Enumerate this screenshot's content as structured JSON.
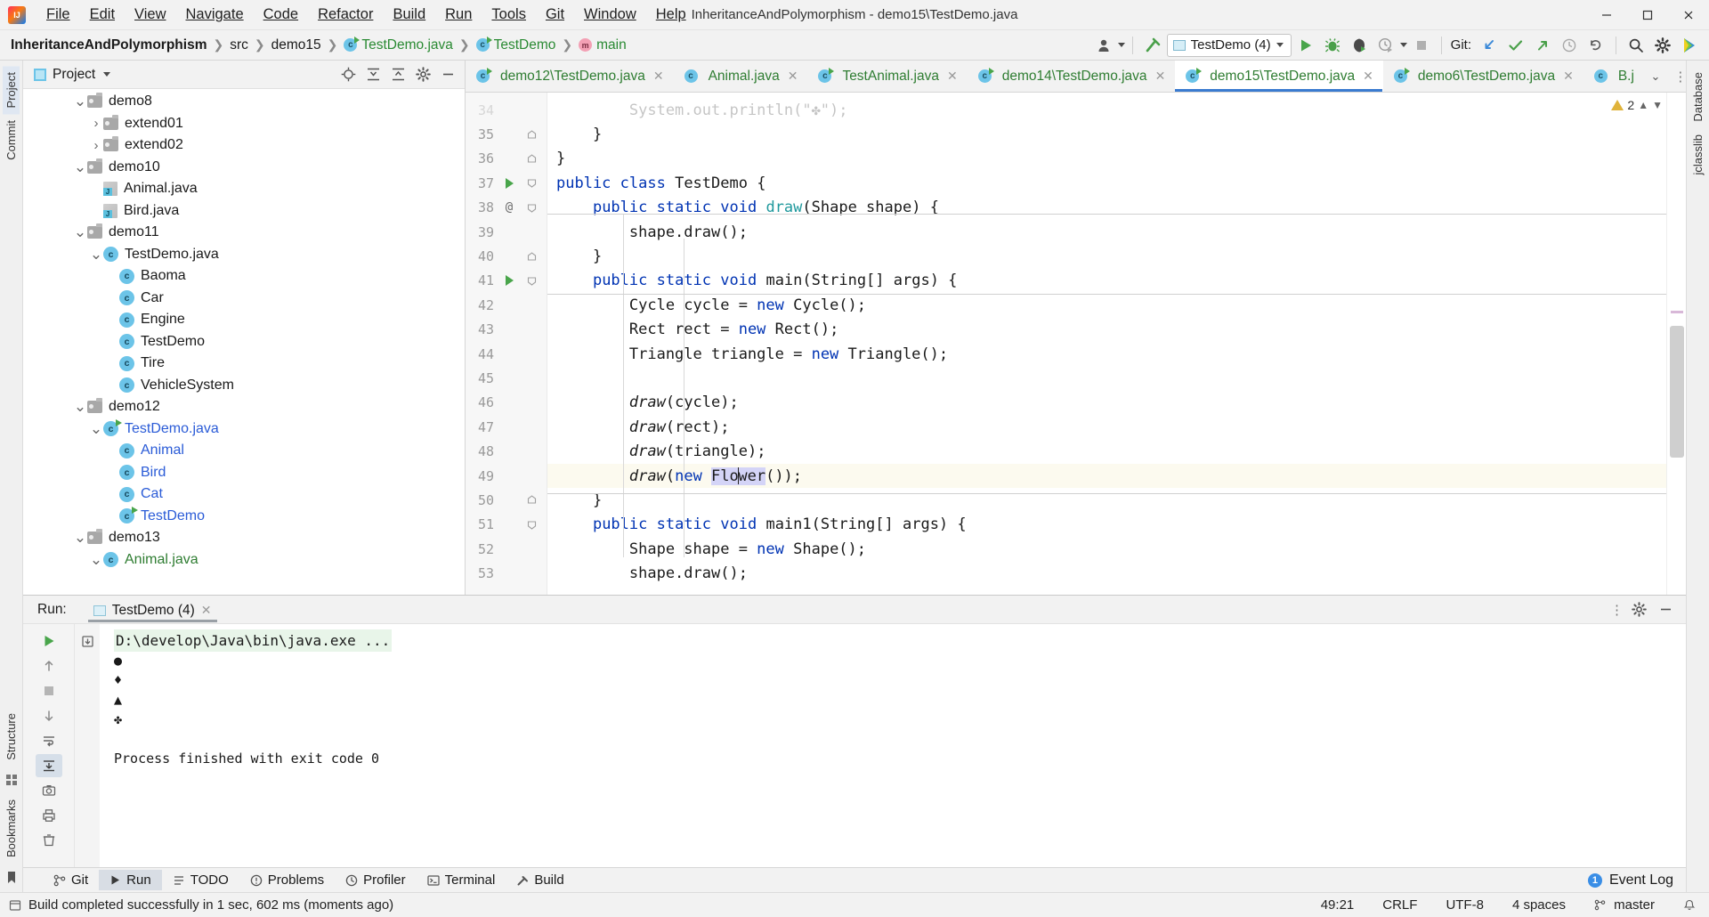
{
  "window": {
    "title": "InheritanceAndPolymorphism - demo15\\TestDemo.java",
    "minimize": "–",
    "maximize": "❐",
    "close": "✕"
  },
  "menu": [
    {
      "label": "File"
    },
    {
      "label": "Edit"
    },
    {
      "label": "View"
    },
    {
      "label": "Navigate"
    },
    {
      "label": "Code"
    },
    {
      "label": "Refactor"
    },
    {
      "label": "Build"
    },
    {
      "label": "Run"
    },
    {
      "label": "Tools"
    },
    {
      "label": "Git"
    },
    {
      "label": "Window"
    },
    {
      "label": "Help"
    }
  ],
  "breadcrumbs": [
    {
      "label": "InheritanceAndPolymorphism",
      "kind": "project"
    },
    {
      "label": "src",
      "kind": "folder"
    },
    {
      "label": "demo15",
      "kind": "folder"
    },
    {
      "label": "TestDemo.java",
      "kind": "class-file"
    },
    {
      "label": "TestDemo",
      "kind": "class"
    },
    {
      "label": "main",
      "kind": "method"
    }
  ],
  "toolbar": {
    "run_config": "TestDemo (4)",
    "git_label": "Git:",
    "icons": [
      "user-avatar-icon",
      "build-hammer-icon",
      "run-icon",
      "debug-icon",
      "run-coverage-icon",
      "profiler-icon",
      "git-update-icon",
      "git-commit-icon",
      "git-push-icon",
      "git-history-icon",
      "git-rollback-icon",
      "search-icon",
      "settings-gear-icon",
      "ide-assistant-icon"
    ]
  },
  "left_rail": [
    {
      "label": "Project",
      "active": true
    },
    {
      "label": "Commit",
      "active": false
    },
    {
      "label": "Structure",
      "active": false
    },
    {
      "label": "Bookmarks",
      "active": false
    }
  ],
  "right_rail": [
    {
      "label": "Database"
    },
    {
      "label": "jclasslib"
    }
  ],
  "project_panel": {
    "title": "Project",
    "tools": [
      "locate-icon",
      "expand-all-icon",
      "collapse-all-icon",
      "settings-icon",
      "hide-icon"
    ],
    "tree": [
      {
        "label": "demo8",
        "indent": 0,
        "icon": "folder",
        "arrow": "down",
        "color": "dark"
      },
      {
        "label": "extend01",
        "indent": 1,
        "icon": "folder",
        "arrow": "right",
        "color": "dark"
      },
      {
        "label": "extend02",
        "indent": 1,
        "icon": "folder",
        "arrow": "right",
        "color": "dark"
      },
      {
        "label": "demo10",
        "indent": 0,
        "icon": "folder",
        "arrow": "down",
        "color": "dark"
      },
      {
        "label": "Animal.java",
        "indent": 1,
        "icon": "java-file",
        "arrow": "none",
        "color": "dark"
      },
      {
        "label": "Bird.java",
        "indent": 1,
        "icon": "java-file",
        "arrow": "none",
        "color": "dark"
      },
      {
        "label": "demo11",
        "indent": 0,
        "icon": "folder",
        "arrow": "down",
        "color": "dark"
      },
      {
        "label": "TestDemo.java",
        "indent": 1,
        "icon": "class",
        "arrow": "down",
        "color": "dark"
      },
      {
        "label": "Baoma",
        "indent": 2,
        "icon": "class",
        "arrow": "none",
        "color": "dark"
      },
      {
        "label": "Car",
        "indent": 2,
        "icon": "class",
        "arrow": "none",
        "color": "dark"
      },
      {
        "label": "Engine",
        "indent": 2,
        "icon": "class",
        "arrow": "none",
        "color": "dark"
      },
      {
        "label": "TestDemo",
        "indent": 2,
        "icon": "class",
        "arrow": "none",
        "color": "dark"
      },
      {
        "label": "Tire",
        "indent": 2,
        "icon": "class",
        "arrow": "none",
        "color": "dark"
      },
      {
        "label": "VehicleSystem",
        "indent": 2,
        "icon": "class",
        "arrow": "none",
        "color": "dark"
      },
      {
        "label": "demo12",
        "indent": 0,
        "icon": "folder",
        "arrow": "down",
        "color": "dark"
      },
      {
        "label": "TestDemo.java",
        "indent": 1,
        "icon": "class-run",
        "arrow": "down",
        "color": "blue"
      },
      {
        "label": "Animal",
        "indent": 2,
        "icon": "class",
        "arrow": "none",
        "color": "blue"
      },
      {
        "label": "Bird",
        "indent": 2,
        "icon": "class",
        "arrow": "none",
        "color": "blue"
      },
      {
        "label": "Cat",
        "indent": 2,
        "icon": "class",
        "arrow": "none",
        "color": "blue"
      },
      {
        "label": "TestDemo",
        "indent": 2,
        "icon": "class-run",
        "arrow": "none",
        "color": "blue"
      },
      {
        "label": "demo13",
        "indent": 0,
        "icon": "folder",
        "arrow": "down",
        "color": "dark"
      },
      {
        "label": "Animal.java",
        "indent": 1,
        "icon": "class",
        "arrow": "down",
        "color": "green"
      }
    ]
  },
  "editor_tabs": [
    {
      "label": "demo12\\TestDemo.java",
      "active": false,
      "icon": "class-run"
    },
    {
      "label": "Animal.java",
      "active": false,
      "icon": "class"
    },
    {
      "label": "TestAnimal.java",
      "active": false,
      "icon": "class-run"
    },
    {
      "label": "demo14\\TestDemo.java",
      "active": false,
      "icon": "class-run"
    },
    {
      "label": "demo15\\TestDemo.java",
      "active": true,
      "icon": "class-run"
    },
    {
      "label": "demo6\\TestDemo.java",
      "active": false,
      "icon": "class-run"
    },
    {
      "label": "B.j",
      "active": false,
      "icon": "class"
    }
  ],
  "editor": {
    "warning_count": "2",
    "lines": [
      {
        "num": "34",
        "partial": true,
        "mark": "",
        "fold": "",
        "tokens": [
          {
            "t": "        System.out.println(\"✤\");",
            "c": "pl"
          }
        ]
      },
      {
        "num": "35",
        "mark": "",
        "fold": "end",
        "tokens": [
          {
            "t": "    }",
            "c": "pl"
          }
        ]
      },
      {
        "num": "36",
        "mark": "",
        "fold": "end",
        "tokens": [
          {
            "t": "}",
            "c": "pl"
          }
        ]
      },
      {
        "num": "37",
        "mark": "run",
        "fold": "open",
        "tokens": [
          {
            "t": "public ",
            "c": "kw"
          },
          {
            "t": "class ",
            "c": "kw"
          },
          {
            "t": "TestDemo {",
            "c": "cls"
          }
        ]
      },
      {
        "num": "38",
        "mark": "at",
        "fold": "open",
        "tokens": [
          {
            "t": "    ",
            "c": "pl"
          },
          {
            "t": "public ",
            "c": "kw"
          },
          {
            "t": "static ",
            "c": "kw"
          },
          {
            "t": "void ",
            "c": "kw"
          },
          {
            "t": "draw",
            "c": "typ"
          },
          {
            "t": "(Shape shape) {",
            "c": "pl"
          }
        ]
      },
      {
        "num": "39",
        "mark": "",
        "fold": "",
        "tokens": [
          {
            "t": "        shape.draw();",
            "c": "pl"
          }
        ]
      },
      {
        "num": "40",
        "mark": "",
        "fold": "end",
        "tokens": [
          {
            "t": "    }",
            "c": "pl"
          }
        ]
      },
      {
        "num": "41",
        "mark": "run",
        "fold": "open",
        "tokens": [
          {
            "t": "    ",
            "c": "pl"
          },
          {
            "t": "public ",
            "c": "kw"
          },
          {
            "t": "static ",
            "c": "kw"
          },
          {
            "t": "void ",
            "c": "kw"
          },
          {
            "t": "main",
            "c": "cls"
          },
          {
            "t": "(String[] args) {",
            "c": "pl"
          }
        ]
      },
      {
        "num": "42",
        "mark": "",
        "fold": "",
        "tokens": [
          {
            "t": "        Cycle cycle = ",
            "c": "pl"
          },
          {
            "t": "new ",
            "c": "kw"
          },
          {
            "t": "Cycle();",
            "c": "pl"
          }
        ]
      },
      {
        "num": "43",
        "mark": "",
        "fold": "",
        "tokens": [
          {
            "t": "        Rect rect = ",
            "c": "pl"
          },
          {
            "t": "new ",
            "c": "kw"
          },
          {
            "t": "Rect();",
            "c": "pl"
          }
        ]
      },
      {
        "num": "44",
        "mark": "",
        "fold": "",
        "tokens": [
          {
            "t": "        Triangle triangle = ",
            "c": "pl"
          },
          {
            "t": "new ",
            "c": "kw"
          },
          {
            "t": "Triangle();",
            "c": "pl"
          }
        ]
      },
      {
        "num": "45",
        "mark": "",
        "fold": "",
        "tokens": [
          {
            "t": "",
            "c": "pl"
          }
        ]
      },
      {
        "num": "46",
        "mark": "",
        "fold": "",
        "tokens": [
          {
            "t": "        ",
            "c": "pl"
          },
          {
            "t": "draw",
            "c": "mth"
          },
          {
            "t": "(cycle);",
            "c": "pl"
          }
        ]
      },
      {
        "num": "47",
        "mark": "",
        "fold": "",
        "tokens": [
          {
            "t": "        ",
            "c": "pl"
          },
          {
            "t": "draw",
            "c": "mth"
          },
          {
            "t": "(rect);",
            "c": "pl"
          }
        ]
      },
      {
        "num": "48",
        "mark": "",
        "fold": "",
        "tokens": [
          {
            "t": "        ",
            "c": "pl"
          },
          {
            "t": "draw",
            "c": "mth"
          },
          {
            "t": "(triangle);",
            "c": "pl"
          }
        ]
      },
      {
        "num": "49",
        "mark": "",
        "fold": "",
        "highlight": true,
        "tokens": [
          {
            "t": "        ",
            "c": "pl"
          },
          {
            "t": "draw",
            "c": "mth"
          },
          {
            "t": "(",
            "c": "pl"
          },
          {
            "t": "new ",
            "c": "kw"
          },
          {
            "t": "Flower",
            "c": "sel"
          },
          {
            "t": "());",
            "c": "pl"
          }
        ]
      },
      {
        "num": "50",
        "mark": "",
        "fold": "end",
        "tokens": [
          {
            "t": "    }",
            "c": "pl"
          }
        ]
      },
      {
        "num": "51",
        "mark": "",
        "fold": "open",
        "tokens": [
          {
            "t": "    ",
            "c": "pl"
          },
          {
            "t": "public ",
            "c": "kw"
          },
          {
            "t": "static ",
            "c": "kw"
          },
          {
            "t": "void ",
            "c": "kw"
          },
          {
            "t": "main1",
            "c": "cls"
          },
          {
            "t": "(String[] args) {",
            "c": "pl"
          }
        ]
      },
      {
        "num": "52",
        "mark": "",
        "fold": "",
        "tokens": [
          {
            "t": "        Shape shape = ",
            "c": "pl"
          },
          {
            "t": "new ",
            "c": "kw"
          },
          {
            "t": "Shape();",
            "c": "pl"
          }
        ]
      },
      {
        "num": "53",
        "mark": "",
        "fold": "",
        "tokens": [
          {
            "t": "        shape.draw();",
            "c": "pl"
          }
        ]
      }
    ]
  },
  "run_panel": {
    "label": "Run:",
    "tab": "TestDemo (4)",
    "console": {
      "command": "D:\\develop\\Java\\bin\\java.exe ...",
      "output": [
        "●",
        "♦",
        "▲",
        "✤",
        "",
        "Process finished with exit code 0"
      ]
    },
    "rail_icons": [
      "rerun-icon",
      "up-stacktrace-icon",
      "stop-icon",
      "down-stacktrace-icon",
      "soft-wrap-icon",
      "scroll-to-end-icon",
      "camera-icon",
      "print-icon",
      "clear-all-icon",
      "export-icon"
    ]
  },
  "bottom_tabs": [
    {
      "label": "Git",
      "icon": "git-icon",
      "active": false
    },
    {
      "label": "Run",
      "icon": "run-icon",
      "active": true
    },
    {
      "label": "TODO",
      "icon": "todo-icon",
      "active": false
    },
    {
      "label": "Problems",
      "icon": "problems-icon",
      "active": false
    },
    {
      "label": "Profiler",
      "icon": "profiler-icon",
      "active": false
    },
    {
      "label": "Terminal",
      "icon": "terminal-icon",
      "active": false
    },
    {
      "label": "Build",
      "icon": "build-icon",
      "active": false
    }
  ],
  "event_log": {
    "label": "Event Log",
    "count": "1"
  },
  "status_bar": {
    "message": "Build completed successfully in 1 sec, 602 ms (moments ago)",
    "caret": "49:21",
    "line_sep": "CRLF",
    "encoding": "UTF-8",
    "indent": "4 spaces",
    "branch": "master"
  },
  "colors": {
    "accent": "#3a7bd0",
    "green": "#2f7d32",
    "keyword": "#0033b3",
    "type": "#20999d",
    "link_blue": "#2a5bd7",
    "console_cmd_bg": "#e8f5e9",
    "warning": "#e0b33a"
  }
}
